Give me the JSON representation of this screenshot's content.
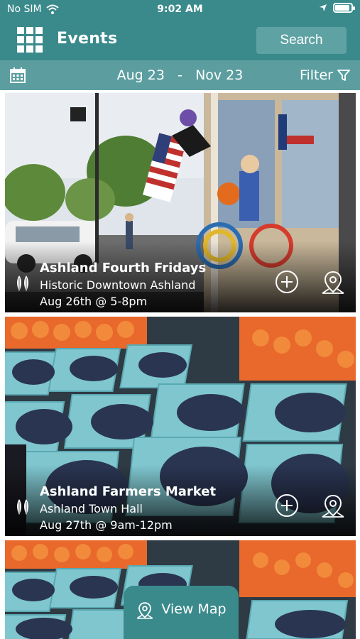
{
  "status": {
    "carrier": "No SIM",
    "time": "9:02 AM"
  },
  "header": {
    "title": "Events",
    "search_label": "Search"
  },
  "date_bar": {
    "start": "Aug 23",
    "separator": "-",
    "end": "Nov 23",
    "filter_label": "Filter"
  },
  "events": [
    {
      "title": "Ashland Fourth Fridays",
      "location": "Historic Downtown Ashland",
      "date": "Aug 26th @ 5-8pm"
    },
    {
      "title": "Ashland Farmers Market",
      "location": "Ashland Town Hall",
      "date": "Aug 27th @ 9am-12pm"
    }
  ],
  "view_map_label": "View Map",
  "colors": {
    "primary": "#3a8a8c",
    "secondary": "#5c9ea0",
    "button": "#5fa2a3"
  }
}
